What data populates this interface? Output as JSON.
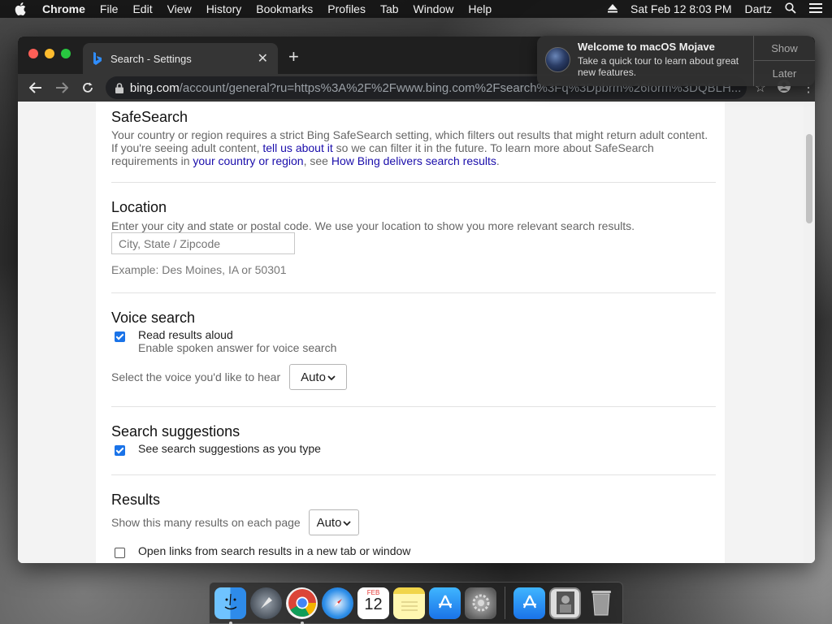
{
  "menubar": {
    "app_name": "Chrome",
    "items": [
      "File",
      "Edit",
      "View",
      "History",
      "Bookmarks",
      "Profiles",
      "Tab",
      "Window",
      "Help"
    ],
    "datetime": "Sat Feb 12  8:03 PM",
    "user": "Dartz"
  },
  "browser": {
    "tab_title": "Search - Settings",
    "url_host": "bing.com",
    "url_path": "/account/general?ru=https%3A%2F%2Fwww.bing.com%2Fsearch%3Fq%3Dpbrm%26form%3DQBLH..."
  },
  "notification": {
    "title": "Welcome to macOS Mojave",
    "body": "Take a quick tour to learn about great new features.",
    "show_label": "Show",
    "later_label": "Later"
  },
  "safesearch": {
    "heading": "SafeSearch",
    "text_1": "Your country or region requires a strict Bing SafeSearch setting, which filters out results that might return adult content. If you're seeing adult content, ",
    "link_1": "tell us about it",
    "text_2": " so we can filter it in the future. To learn more about SafeSearch requirements in ",
    "link_2": "your country or region",
    "text_3": ", see ",
    "link_3": "How Bing delivers search results",
    "text_4": "."
  },
  "location": {
    "heading": "Location",
    "description": "Enter your city and state or postal code. We use your location to show you more relevant search results.",
    "placeholder": "City, State / Zipcode",
    "example": "Example: Des Moines, IA or 50301"
  },
  "voice": {
    "heading": "Voice search",
    "option_label": "Read results aloud",
    "option_sub": "Enable spoken answer for voice search",
    "option_checked": true,
    "voice_prompt": "Select the voice you'd like to hear",
    "voice_value": "Auto"
  },
  "suggestions": {
    "heading": "Search suggestions",
    "option_label": "See search suggestions as you type",
    "option_checked": true
  },
  "results": {
    "heading": "Results",
    "count_prompt": "Show this many results on each page",
    "count_value": "Auto",
    "new_tab_label": "Open links from search results in a new tab or window",
    "new_tab_checked": false
  },
  "dock": {
    "calendar_month": "FEB",
    "calendar_day": "12"
  }
}
